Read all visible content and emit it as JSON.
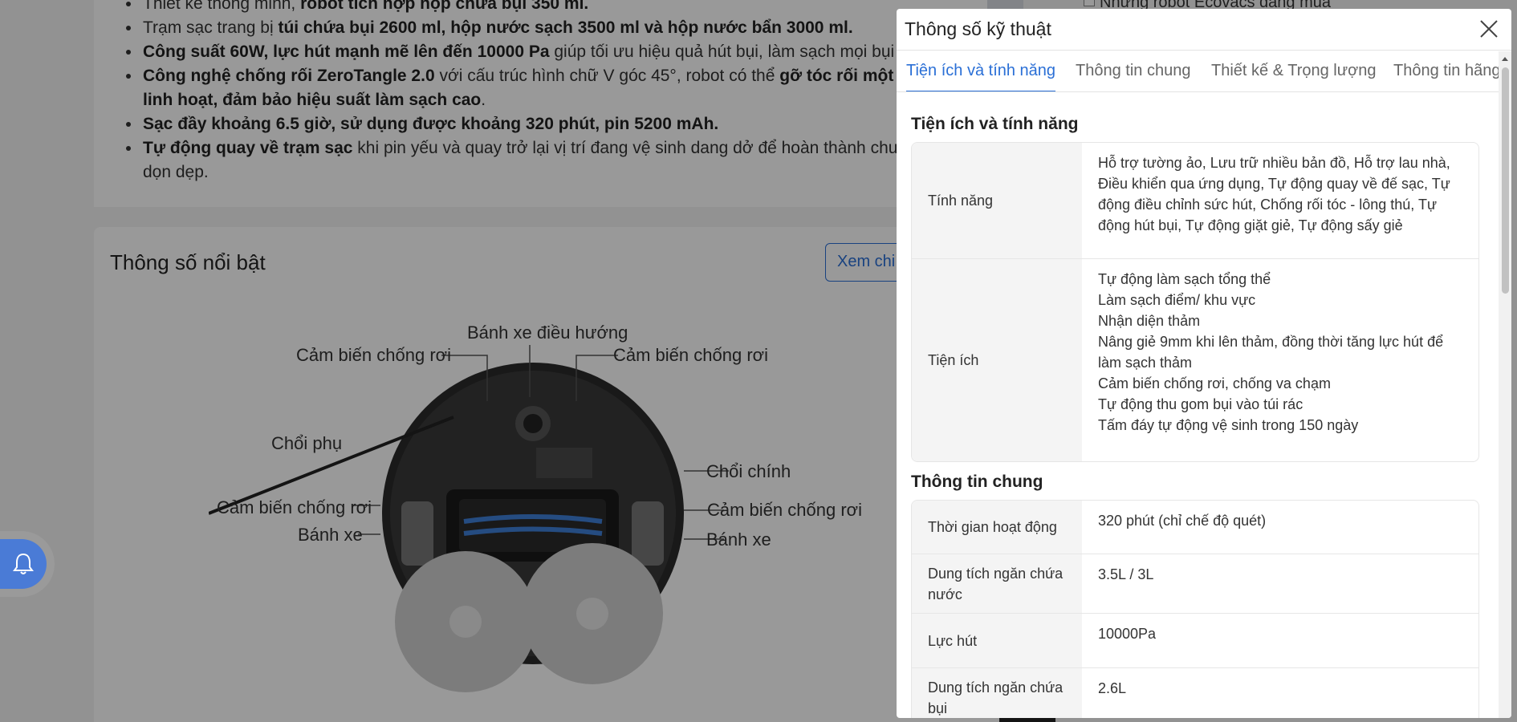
{
  "background": {
    "bullets": [
      {
        "normal1": "Thiết kế thông minh, ",
        "bold1": "robot tích hợp hộp chứa bụi 350 ml.",
        "normal2": ""
      },
      {
        "normal1": "Trạm sạc trang bị ",
        "bold1": "túi chứa bụi 2600 ml, hộp nước sạch 3500 ml và hộp nước bẩn 3000 ml.",
        "normal2": ""
      },
      {
        "normal1": "",
        "bold1": "Công suất 60W, lực hút mạnh mẽ lên đến 10000 Pa",
        "normal2": " giúp tối ưu hiệu quả hút bụi, làm sạch mọi bụi b"
      },
      {
        "normal1": "",
        "bold1": "Công nghệ chống rối ZeroTangle 2.0",
        "normal2": " với cấu trúc hình chữ V góc 45°, robot có thể ",
        "bold2": "gỡ tóc rối một cá"
      },
      {
        "normal1": "",
        "bold1": "linh hoạt, đảm bảo hiệu suất làm sạch cao",
        "normal2": ".",
        "continuation": true
      },
      {
        "normal1": "",
        "bold1": "Sạc đầy khoảng 6.5 giờ, sử dụng được khoảng 320 phút, pin 5200 mAh.",
        "normal2": ""
      },
      {
        "normal1": "",
        "bold1": "Tự động quay về trạm sạc",
        "normal2": " khi pin yếu và quay trở lại vị trí đang vệ sinh dang dở để hoàn thành chu t"
      },
      {
        "normal1": "dọn dẹp.",
        "bold1": "",
        "normal2": "",
        "continuation": true
      }
    ],
    "specs_title": "Thông số nổi bật",
    "xem_button": "Xem chi",
    "side_text": "Những robot Ecovacs đang mua",
    "diagram_labels": {
      "nav_wheel": "Bánh xe điều hướng",
      "cliff_top_left": "Cảm biến chống rơi",
      "cliff_top_right": "Cảm biến chống rơi",
      "side_brush": "Chổi phụ",
      "main_brush": "Chổi chính",
      "cliff_left": "Cảm biến chống rơi",
      "cliff_right": "Cảm biến chống rơi",
      "wheel_left": "Bánh xe",
      "wheel_right": "Bánh xe"
    }
  },
  "modal": {
    "title": "Thông số kỹ thuật",
    "tabs": [
      {
        "label": "Tiện ích và tính năng",
        "active": true
      },
      {
        "label": "Thông tin chung",
        "active": false
      },
      {
        "label": "Thiết kế & Trọng lượng",
        "active": false
      },
      {
        "label": "Thông tin hãng",
        "active": false
      }
    ],
    "sections": [
      {
        "title": "Tiện ích và tính năng",
        "rows": [
          {
            "label": "Tính năng",
            "value": [
              "Hỗ trợ tường ảo, Lưu trữ nhiều bản đồ, Hỗ trợ lau nhà, Điều khiển qua ứng dụng, Tự động quay về đế sạc, Tự động điều chỉnh sức hút, Chống rối tóc - lông thú, Tự động hút bụi, Tự động giặt giẻ, Tự động sấy giẻ"
            ]
          },
          {
            "label": "Tiện ích",
            "value": [
              "Tự động làm sạch tổng thể",
              "Làm sạch điểm/ khu vực",
              "Nhận diện thảm",
              "Nâng giẻ 9mm khi lên thảm, đồng thời tăng lực hút để làm sạch thảm",
              "Cảm biến chống rơi, chống va chạm",
              "Tự động thu gom bụi vào túi rác",
              "Tấm đáy tự động vệ sinh trong 150 ngày"
            ]
          }
        ]
      },
      {
        "title": "Thông tin chung",
        "rows": [
          {
            "label": "Thời gian hoạt động",
            "value": [
              "320 phút (chỉ chế độ quét)"
            ]
          },
          {
            "label": "Dung tích ngăn chứa nước",
            "value": [
              "3.5L / 3L"
            ]
          },
          {
            "label": "Lực hút",
            "value": [
              "10000Pa"
            ]
          },
          {
            "label": "Dung tích ngăn chứa bụi",
            "value": [
              "2.6L"
            ]
          }
        ]
      }
    ]
  }
}
